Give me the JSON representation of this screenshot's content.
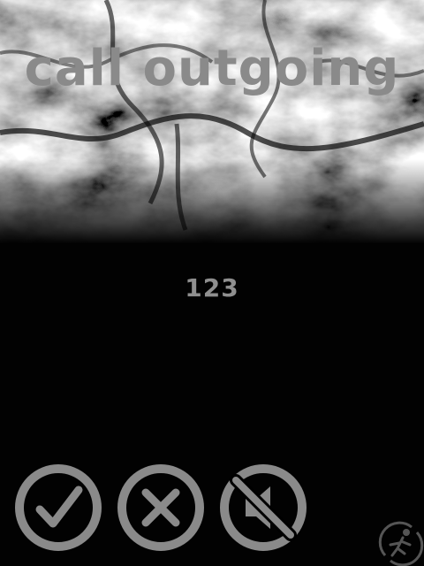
{
  "screen": {
    "title": "call outgoing",
    "number": "123"
  },
  "actions": [
    {
      "id": "accept",
      "icon": "checkmark-icon"
    },
    {
      "id": "reject",
      "icon": "cross-icon"
    },
    {
      "id": "mute",
      "icon": "speaker-muted-icon"
    }
  ],
  "corner": {
    "icon": "runner-logo-icon"
  },
  "colors": {
    "background": "#020202",
    "text": "#8a8a8a",
    "icon": "#8a8a8a",
    "cloud_light": "#9a9a9a",
    "cloud_dark": "#141414"
  }
}
